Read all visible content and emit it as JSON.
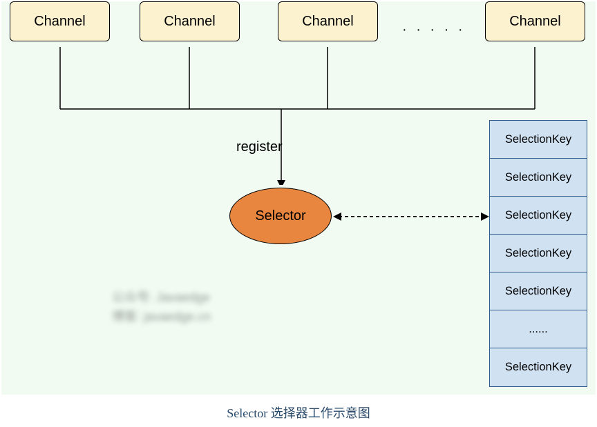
{
  "channels": {
    "label1": "Channel",
    "label2": "Channel",
    "label3": "Channel",
    "label4": "Channel",
    "dots": "· · · · ·"
  },
  "register_label": "register",
  "selector_label": "Selector",
  "selection_keys": [
    "SelectionKey",
    "SelectionKey",
    "SelectionKey",
    "SelectionKey",
    "SelectionKey",
    "......",
    "SelectionKey"
  ],
  "watermark": {
    "line1": "公众号: Javaedge",
    "line2": "博客: javaedge.cn"
  },
  "caption": "Selector 选择器工作示意图"
}
